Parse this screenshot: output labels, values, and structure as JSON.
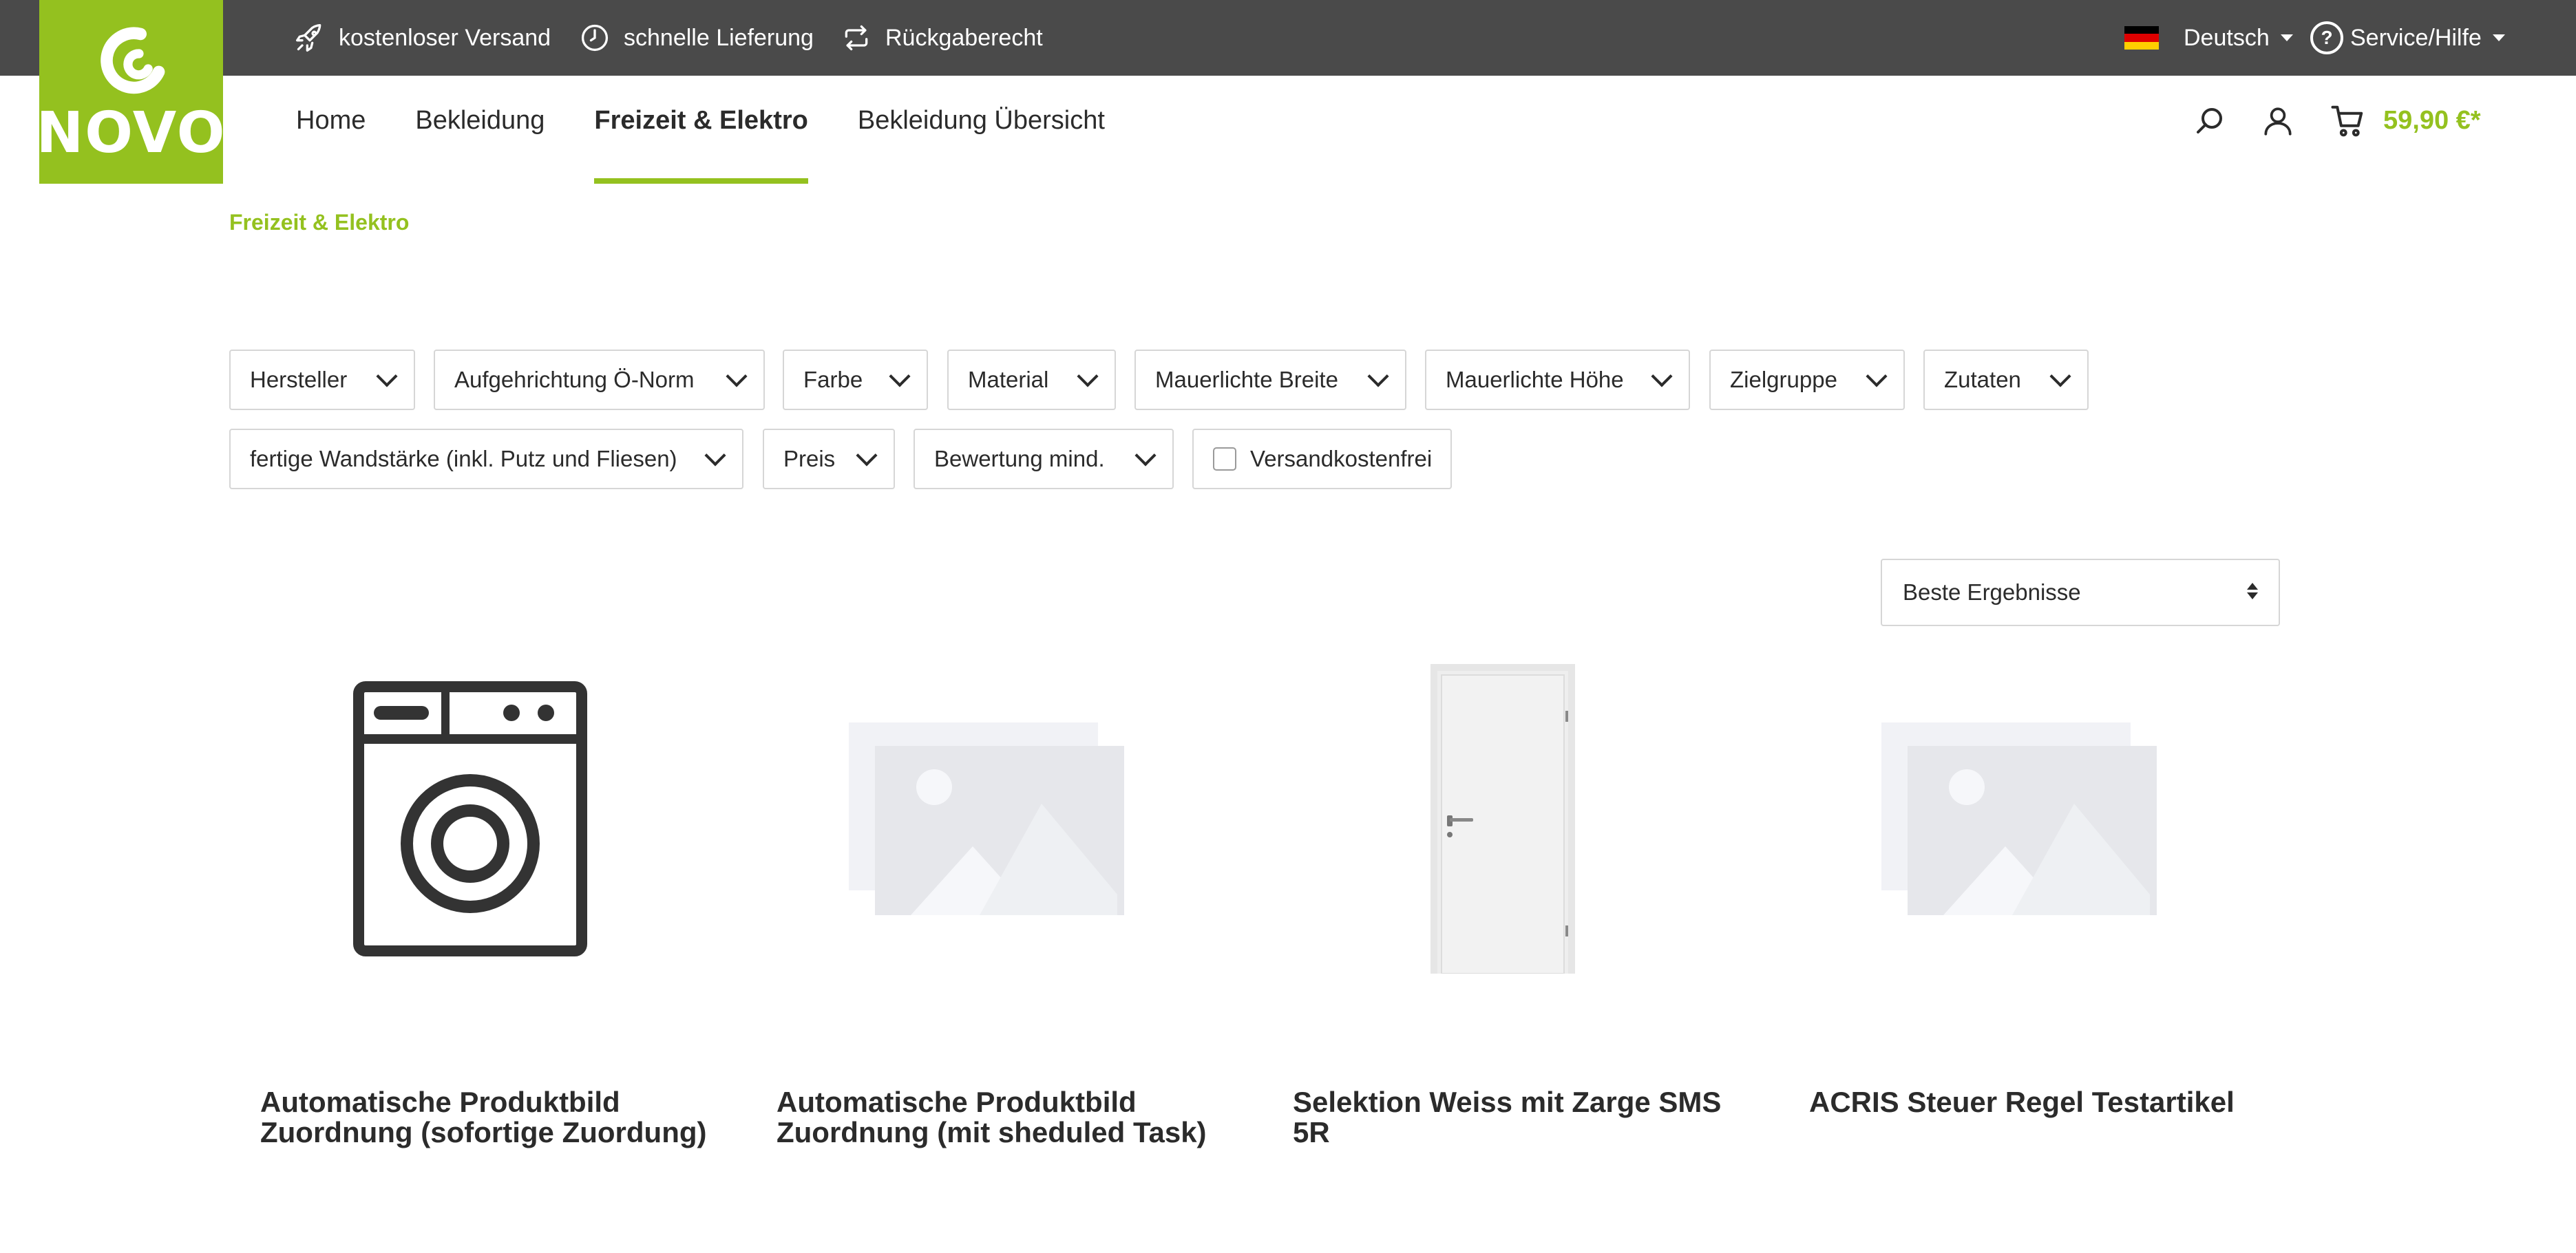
{
  "topbar": {
    "usps": [
      {
        "icon": "rocket-icon",
        "label": "kostenloser Versand"
      },
      {
        "icon": "clock-icon",
        "label": "schnelle Lieferung"
      },
      {
        "icon": "return-arrows-icon",
        "label": "Rückgaberecht"
      }
    ],
    "language": {
      "flag": "de-flag-icon",
      "label": "Deutsch"
    },
    "service": {
      "icon": "help-circle-icon",
      "label": "Service/Hilfe"
    }
  },
  "logo": {
    "text": "NOVO",
    "color": "#94c11f"
  },
  "nav": {
    "items": [
      {
        "label": "Home",
        "active": false
      },
      {
        "label": "Bekleidung",
        "active": false
      },
      {
        "label": "Freizeit & Elektro",
        "active": true
      },
      {
        "label": "Bekleidung Übersicht",
        "active": false
      }
    ]
  },
  "header": {
    "search_icon": "search-icon",
    "account_icon": "user-icon",
    "cart_icon": "cart-icon",
    "cart_total": "59,90 €*"
  },
  "breadcrumb": "Freizeit & Elektro",
  "filters": {
    "row1": [
      "Hersteller",
      "Aufgehrichtung Ö-Norm",
      "Farbe",
      "Material",
      "Mauerlichte Breite",
      "Mauerlichte Höhe",
      "Zielgruppe",
      "Zutaten"
    ],
    "row2": [
      "fertige Wandstärke (inkl. Putz und Fliesen)",
      "Preis",
      "Bewertung mind."
    ],
    "checkbox": {
      "label": "Versandkostenfrei",
      "checked": false
    }
  },
  "sort": {
    "selected": "Beste Ergebnisse"
  },
  "products": [
    {
      "title": "Automatische Produktbild Zuordnung (sofortige Zuordung)",
      "image": "washing-machine-icon"
    },
    {
      "title": "Automatische Produktbild Zuordnung (mit sheduled Task)",
      "image": "placeholder-image-icon"
    },
    {
      "title": "Selektion Weiss mit Zarge SMS 5R",
      "image": "white-door-image"
    },
    {
      "title": "ACRIS Steuer Regel Testartikel",
      "image": "placeholder-image-icon"
    }
  ],
  "colors": {
    "accent": "#94c11f",
    "topbar": "#4a4a4a",
    "text": "#2b2b2b",
    "border": "#d6d6d6"
  }
}
